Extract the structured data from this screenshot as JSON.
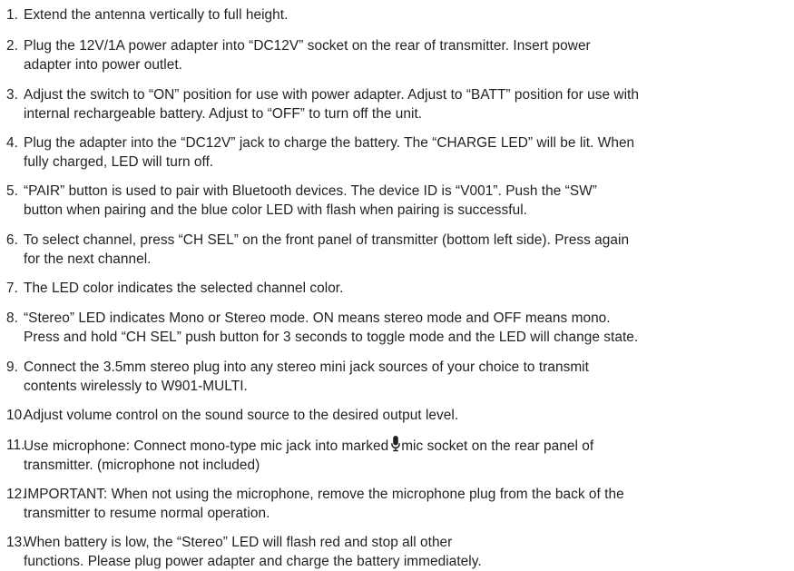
{
  "instructions": [
    {
      "num": "1.",
      "text": "Extend the antenna vertically to full height."
    },
    {
      "num": "2.",
      "text": "Plug the 12V/1A power adapter into “DC12V” socket on the rear of transmitter. Insert power\nadapter into power outlet."
    },
    {
      "num": "3.",
      "text": "Adjust the switch to “ON” position for use with power adapter. Adjust to “BATT” position for use with\ninternal rechargeable battery. Adjust to “OFF” to turn off the unit."
    },
    {
      "num": "4.",
      "text": "Plug the adapter into the “DC12V” jack to charge the battery. The “CHARGE LED” will be lit. When\nfully charged, LED will turn off."
    },
    {
      "num": "5.",
      "text": "“PAIR” button is used to pair with Bluetooth devices. The device ID is “V001”. Push the “SW”\nbutton when pairing and the blue color LED with flash when pairing is successful."
    },
    {
      "num": "6.",
      "text": "To select channel, press “CH SEL” on the front panel of transmitter (bottom left side). Press again\nfor the next channel."
    },
    {
      "num": "7.",
      "text": "The LED color indicates the selected channel color."
    },
    {
      "num": "8.",
      "text": "“Stereo” LED indicates Mono or Stereo mode. ON means stereo mode and OFF means mono.\nPress and hold “CH SEL” push button for 3 seconds to toggle mode and the LED will change state."
    },
    {
      "num": "9.",
      "text": "Connect the 3.5mm stereo plug into any stereo mini jack sources of your choice to transmit\ncontents wirelessly to W901-MULTI."
    },
    {
      "num": "10.",
      "text": "Adjust volume control on the sound source to the desired output level."
    },
    {
      "num": "11.",
      "text_before_icon": "Use microphone: Connect mono-type mic jack into marked",
      "icon": "microphone-icon",
      "text_after_icon": "mic socket on the rear panel of\ntransmitter. (microphone not included)"
    },
    {
      "num": "12.",
      "text": "IMPORTANT: When not using the microphone, remove the microphone plug from the back of the\ntransmitter to resume normal operation."
    },
    {
      "num": "13.",
      "text": "When battery is low, the “Stereo” LED will flash red and stop all other\nfunctions. Please plug power adapter and charge the battery immediately."
    }
  ]
}
